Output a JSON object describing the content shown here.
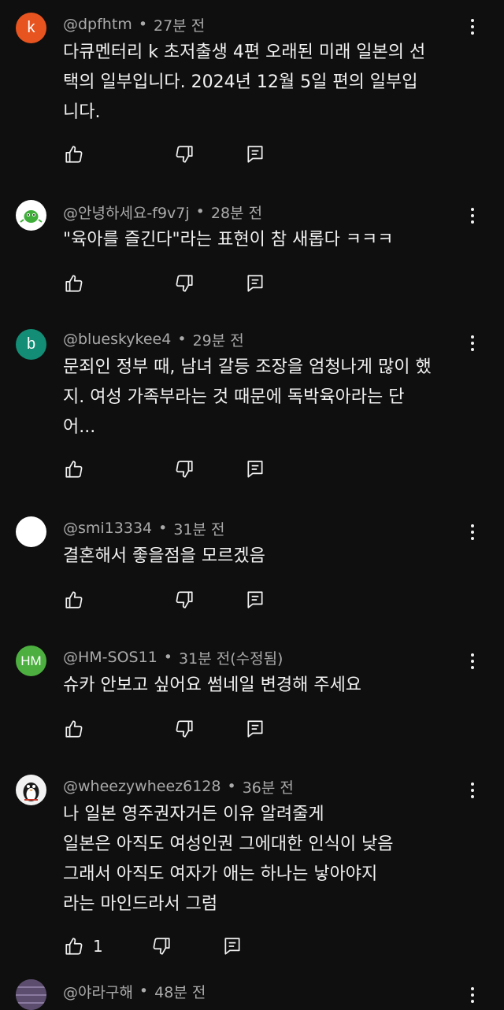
{
  "comments": [
    {
      "avatar": {
        "letter": "k",
        "color": "#e8541f"
      },
      "author": "@dpfhtm",
      "time": "27분 전",
      "text": "다큐멘터리 k 초저출생 4편 오래된 미래 일본의 선\n택의 일부입니다. 2024년 12월 5일 편의 일부입\n니다.",
      "likes": ""
    },
    {
      "avatar": {
        "letter": "",
        "color": "#ffffff",
        "image": "green-character"
      },
      "author": "@안녕하세요-f9v7j",
      "time": "28분 전",
      "text": "\"육아를 즐긴다\"라는 표현이 참 새롭다 ㅋㅋㅋ",
      "likes": ""
    },
    {
      "avatar": {
        "letter": "b",
        "color": "#138d75"
      },
      "author": "@blueskykee4",
      "time": "29분 전",
      "text": "문죄인 정부 때, 남녀 갈등 조장을 엄청나게 많이 했\n지. 여성 가족부라는 것 때문에 독박육아라는 단\n어...",
      "likes": ""
    },
    {
      "avatar": {
        "letter": "",
        "color": "#ffffff"
      },
      "author": "@smi13334",
      "time": "31분 전",
      "text": "결혼해서 좋을점을 모르겠음",
      "likes": ""
    },
    {
      "avatar": {
        "letter": "HM",
        "color": "#4caf3f"
      },
      "author": "@HM-SOS11",
      "time": "31분 전(수정됨)",
      "text": "슈카 안보고 싶어요  썸네일 변경해 주세요",
      "likes": ""
    },
    {
      "avatar": {
        "letter": "",
        "color": "#f2f2f2",
        "image": "penguin"
      },
      "author": "@wheezywheez6128",
      "time": "36분 전",
      "text": "나 일본 영주권자거든 이유 알려줄게\n일본은 아직도 여성인권 그에대한 인식이 낮음\n그래서 아직도 여자가 애는 하나는 낳아야지\n라는 마인드라서 그럼",
      "likes": "1"
    },
    {
      "avatar": {
        "letter": "",
        "color": "#6b5a7a",
        "image": "pattern"
      },
      "author": "@야라구해",
      "time": "48분 전",
      "text": "",
      "likes": ""
    }
  ],
  "icons": {
    "like": "thumbs-up-icon",
    "dislike": "thumbs-down-icon",
    "reply": "reply-comment-icon",
    "more": "more-vert-icon"
  }
}
